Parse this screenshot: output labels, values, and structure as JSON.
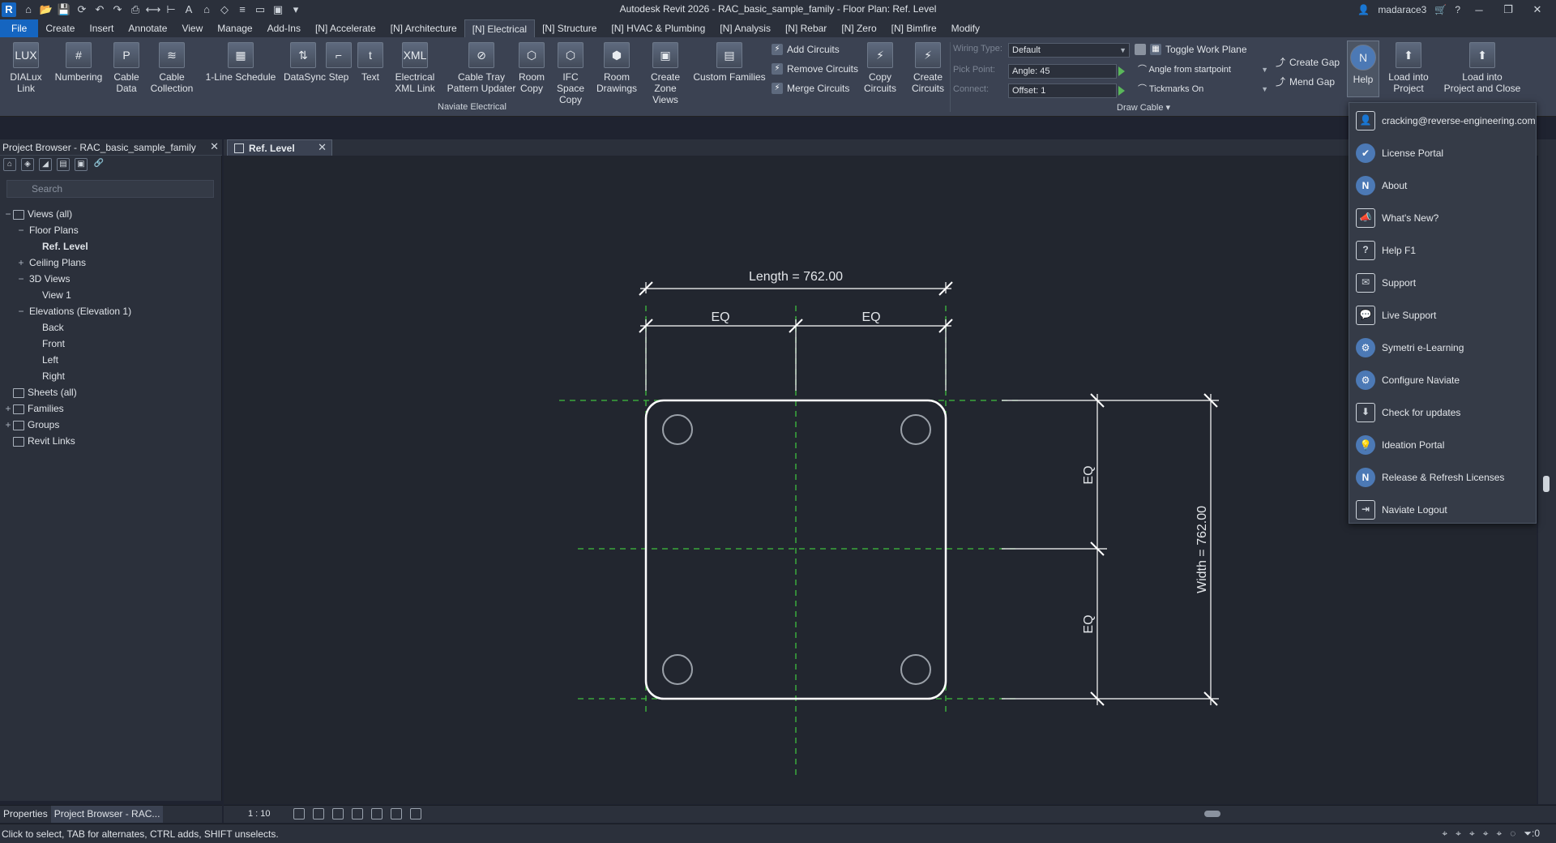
{
  "title_bar": {
    "title": "Autodesk Revit 2026 - RAC_basic_sample_family - Floor Plan: Ref. Level",
    "app_logo": "R",
    "user": "madarace3"
  },
  "menu": {
    "tabs": [
      "File",
      "Create",
      "Insert",
      "Annotate",
      "View",
      "Manage",
      "Add-Ins",
      "[N] Accelerate",
      "[N] Architecture",
      "[N] Electrical",
      "[N] Structure",
      "[N] HVAC & Plumbing",
      "[N] Analysis",
      "[N] Rebar",
      "[N] Zero",
      "[N] Bimfire",
      "Modify"
    ],
    "active_tab": "[N] Electrical"
  },
  "ribbon": {
    "buttons": [
      {
        "label": "DIALux\nLink",
        "icon": "LUX"
      },
      {
        "label": "Numbering",
        "icon": "#"
      },
      {
        "label": "Cable\nData",
        "icon": "P"
      },
      {
        "label": "Cable\nCollection",
        "icon": "≋"
      },
      {
        "label": "1-Line Schedule",
        "icon": "▦"
      },
      {
        "label": "DataSync",
        "icon": "⇅"
      },
      {
        "label": "Step",
        "icon": "⌐"
      },
      {
        "label": "Text",
        "icon": "t"
      },
      {
        "label": "Electrical\nXML Link",
        "icon": "XML"
      },
      {
        "label": "Cable Tray\nPattern Updater",
        "icon": "⊘"
      },
      {
        "label": "Room\nCopy",
        "icon": "⬡"
      },
      {
        "label": "IFC Space\nCopy",
        "icon": "⬡"
      },
      {
        "label": "Room\nDrawings",
        "icon": "⬢"
      },
      {
        "label": "Create\nZone Views",
        "icon": "▣"
      },
      {
        "label": "Custom Families",
        "icon": "▤"
      }
    ],
    "circuit_tools": [
      "Add  Circuits",
      "Remove Circuits",
      "Merge Circuits"
    ],
    "copy_circuits": {
      "label": "Copy\nCircuits",
      "icon": "⚡"
    },
    "create_circuits": {
      "label": "Create\nCircuits",
      "icon": "⚡"
    },
    "panel_label": "Naviate Electrical",
    "options": {
      "wiring_type_label": "Wiring Type:",
      "wiring_type_value": "Default",
      "pick_point_label": "Pick Point:",
      "angle_value": "Angle: 45",
      "connect_label": "Connect:",
      "offset_value": "Offset: 1",
      "toggle_work_plane": "Toggle Work Plane",
      "angle_mode": "Angle from startpoint",
      "tickmarks": "Tickmarks On",
      "create_gap": "Create Gap",
      "mend_gap": "Mend Gap",
      "draw_cable_label": "Draw Cable"
    },
    "help_button": {
      "label": "Help",
      "icon": "N"
    },
    "load_into_project": {
      "label": "Load into\nProject",
      "icon": "⬆"
    },
    "load_and_close": {
      "label": "Load into\nProject and Close",
      "icon": "⬆"
    }
  },
  "project_browser": {
    "title": "Project Browser - RAC_basic_sample_family",
    "search_placeholder": "Search",
    "tree": [
      {
        "label": "Views (all)",
        "indent": 0,
        "toggle": "−",
        "icon": true,
        "bold": false
      },
      {
        "label": "Floor Plans",
        "indent": 1,
        "toggle": "−",
        "icon": false,
        "bold": false
      },
      {
        "label": "Ref. Level",
        "indent": 2,
        "toggle": "",
        "icon": false,
        "bold": true
      },
      {
        "label": "Ceiling Plans",
        "indent": 1,
        "toggle": "+",
        "icon": false,
        "bold": false
      },
      {
        "label": "3D Views",
        "indent": 1,
        "toggle": "−",
        "icon": false,
        "bold": false
      },
      {
        "label": "View 1",
        "indent": 2,
        "toggle": "",
        "icon": false,
        "bold": false
      },
      {
        "label": "Elevations (Elevation 1)",
        "indent": 1,
        "toggle": "−",
        "icon": false,
        "bold": false
      },
      {
        "label": "Back",
        "indent": 2,
        "toggle": "",
        "icon": false,
        "bold": false
      },
      {
        "label": "Front",
        "indent": 2,
        "toggle": "",
        "icon": false,
        "bold": false
      },
      {
        "label": "Left",
        "indent": 2,
        "toggle": "",
        "icon": false,
        "bold": false
      },
      {
        "label": "Right",
        "indent": 2,
        "toggle": "",
        "icon": false,
        "bold": false
      },
      {
        "label": "Sheets (all)",
        "indent": 0,
        "toggle": "",
        "icon": true,
        "bold": false
      },
      {
        "label": "Families",
        "indent": 0,
        "toggle": "+",
        "icon": true,
        "bold": false
      },
      {
        "label": "Groups",
        "indent": 0,
        "toggle": "+",
        "icon": true,
        "bold": false
      },
      {
        "label": "Revit Links",
        "indent": 0,
        "toggle": "",
        "icon": true,
        "bold": false
      }
    ]
  },
  "view_tab": {
    "label": "Ref. Level"
  },
  "drawing": {
    "length_label": "Length = 762.00",
    "width_label": "Width = 762.00",
    "eq_label": "EQ"
  },
  "view_control": {
    "scale": "1 : 10"
  },
  "bottom_tabs": [
    "Properties",
    "Project Browser - RAC..."
  ],
  "status": {
    "text": "Click to select, TAB for alternates, CTRL adds, SHIFT unselects.",
    "filter_count": ":0"
  },
  "help_menu": {
    "items": [
      {
        "label": "cracking@reverse-engineering.com",
        "icon": "👤",
        "style": "sq"
      },
      {
        "label": "License Portal",
        "icon": "✔",
        "style": "circle"
      },
      {
        "label": "About",
        "icon": "N",
        "style": "circle"
      },
      {
        "label": "What's New?",
        "icon": "📣",
        "style": "sq"
      },
      {
        "label": "Help F1",
        "icon": "?",
        "style": "sq"
      },
      {
        "label": "Support",
        "icon": "✉",
        "style": "sq"
      },
      {
        "label": "Live Support",
        "icon": "💬",
        "style": "sq"
      },
      {
        "label": "Symetri e-Learning",
        "icon": "⚙",
        "style": "circle"
      },
      {
        "label": "Configure Naviate",
        "icon": "⚙",
        "style": "circle"
      },
      {
        "label": "Check for updates",
        "icon": "⬇",
        "style": "sq"
      },
      {
        "label": "Ideation Portal",
        "icon": "💡",
        "style": "circle"
      },
      {
        "label": "Release & Refresh Licenses",
        "icon": "N",
        "style": "circle"
      },
      {
        "label": "Naviate Logout",
        "icon": "⇥",
        "style": "sq"
      }
    ]
  },
  "colors": {
    "accent": "#1565c0",
    "ribbon_bg": "#3b4252",
    "canvas_bg": "#22262f",
    "reference_plane": "#3fbf3f",
    "geometry": "#ffffff"
  }
}
